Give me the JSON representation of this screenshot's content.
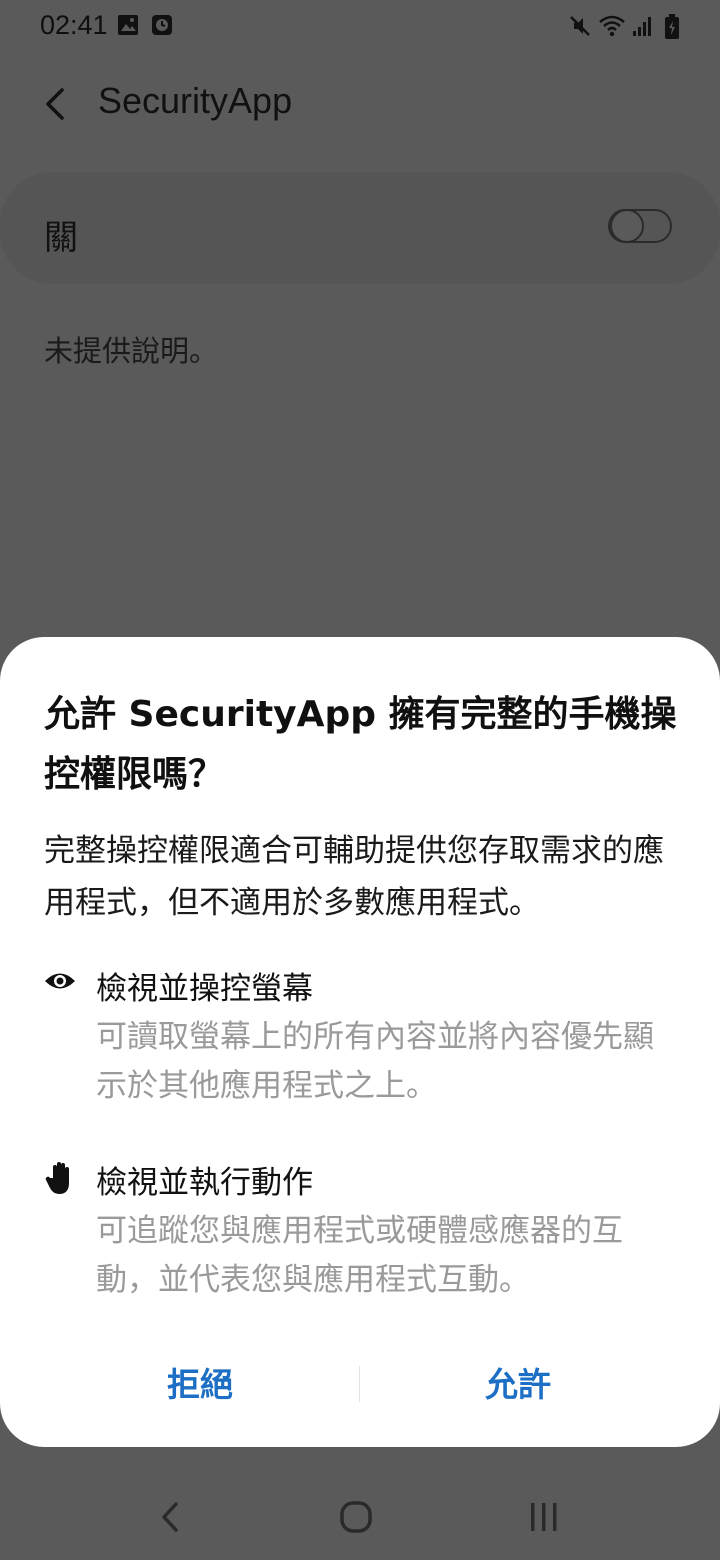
{
  "status_bar": {
    "time": "02:41",
    "icons_left": [
      "image-icon",
      "clock-icon"
    ],
    "icons_right": [
      "mute-icon",
      "wifi-icon",
      "signal-icon",
      "battery-icon"
    ]
  },
  "header": {
    "title": "SecurityApp"
  },
  "toggle": {
    "label": "關",
    "state": "off"
  },
  "description": "未提供說明。",
  "dialog": {
    "title": "允許 SecurityApp 擁有完整的手機操控權限嗎？",
    "body": "完整操控權限適合可輔助提供您存取需求的應用程式，但不適用於多數應用程式。",
    "permissions": [
      {
        "icon": "eye-icon",
        "title": "檢視並操控螢幕",
        "description": "可讀取螢幕上的所有內容並將內容優先顯示於其他應用程式之上。"
      },
      {
        "icon": "hand-icon",
        "title": "檢視並執行動作",
        "description": "可追蹤您與應用程式或硬體感應器的互動，並代表您與應用程式互動。"
      }
    ],
    "deny_label": "拒絕",
    "allow_label": "允許",
    "accent_color": "#1c6fc4"
  },
  "nav_bar": {
    "buttons": [
      "back-icon",
      "home-icon",
      "recents-icon"
    ]
  }
}
